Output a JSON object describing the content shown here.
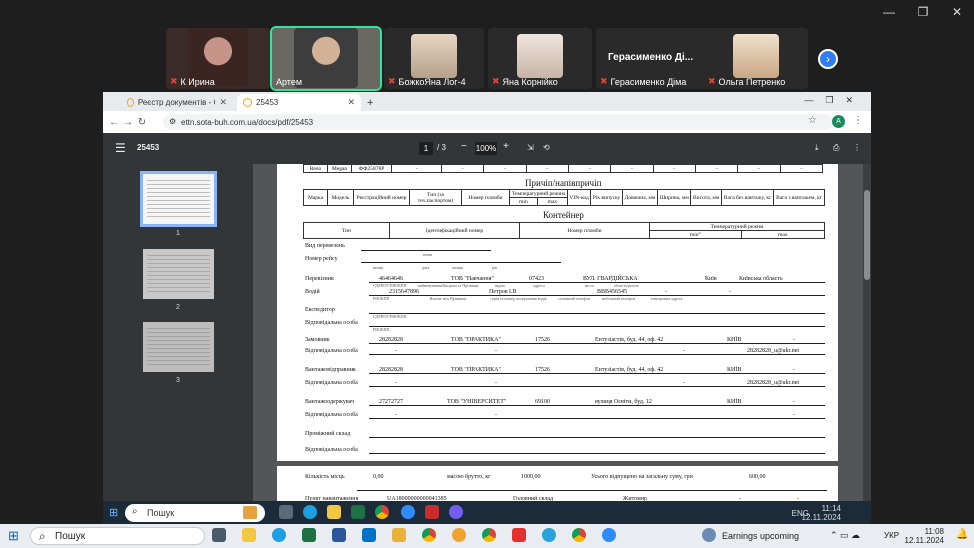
{
  "meeting": {
    "participants": [
      {
        "name": "К Ирина"
      },
      {
        "name": "Артем"
      },
      {
        "name": "БожкоЯна Лог-4"
      },
      {
        "name": "Яна Корнійко"
      },
      {
        "name": "Герасименко Діма",
        "header": "Герасименко  Ді..."
      },
      {
        "name": "Ольга Петренко"
      }
    ]
  },
  "browser": {
    "tabs": [
      {
        "label": "Реєстр документів - СОТА Е-Т"
      },
      {
        "label": "25453"
      }
    ],
    "url": "ettn.sota-buh.com.ua/docs/pdf/25453",
    "profile_initial": "A"
  },
  "pdf": {
    "title": "25453",
    "current_page": "1",
    "total_pages": "/ 3",
    "zoom": "100%",
    "thumbnails": [
      "1",
      "2",
      "3"
    ]
  },
  "document": {
    "top_row": {
      "make": "Reno",
      "model": "Megan",
      "reg": "ФФ25878Р",
      "dash": "-"
    },
    "trailers_title": "Причіп/напівпричіп",
    "trailer_headers": [
      "Марка",
      "Модель",
      "Реєстраційний номер",
      "Тип (за тех.паспортом)",
      "Номер пломби",
      "Температурний режим",
      "VIN-код",
      "Рік випуску",
      "Довжина, мм",
      "Ширина, мм",
      "Висота, мм",
      "Вага без вантажу, кг",
      "Вага з вантажем, кг"
    ],
    "temp_min": "min",
    "temp_max": "max",
    "container_title": "Контейнер",
    "container_headers": [
      "Тип",
      "Ідентифікаційний номер",
      "Номер пломби",
      "Температурний режим"
    ],
    "container_temp_min": "min°",
    "container_temp_max": "max",
    "transport_kind_label": "Вид перевезень",
    "trip_number_label": "Номер рейсу",
    "tiny_labels": {
      "kind": "назва",
      "route": "номер",
      "date": "дата",
      "month": "місяць",
      "year": "рік"
    },
    "sub": {
      "entity": "ЄДРПОУ/РНОКПП",
      "name": "найменування/Ініціали та Прізвище",
      "index": "індекс",
      "address": "адреса",
      "city": "місто",
      "region": "область/регіон",
      "rnokpp": "РНОКПП",
      "fio": "Власне ім'я Прізвище",
      "doc": "серія та номер посвідчення водія",
      "phone": "основний телефон",
      "mobile": "мобільний телефон",
      "email": "електронна адреса"
    },
    "carrier": {
      "label": "Перевізник",
      "code": "46464646",
      "name": "ТОВ \"Навчання\"",
      "index": "07423",
      "street": "ВУЛ. ГВАРДІЙСЬКА",
      "city": "Київ",
      "dash": "-",
      "region": "Київська область"
    },
    "driver": {
      "label": "Водій",
      "rnokpp": "2315647896",
      "name": "Петров І.В",
      "doc": "ВВВ456545",
      "dash": "-"
    },
    "forwarder": {
      "label": "Експедитор"
    },
    "responsible_label": "Відповідальна особа",
    "customer": {
      "label": "Замовник",
      "code": "28282828",
      "name": "ТОВ \"ПРАКТИКА\"",
      "index": "17526",
      "street": "Ентузіастів, буд. 44, оф. 42",
      "city": "КИЇВ",
      "dash": "-",
      "email": "28282828_u@ukr.net"
    },
    "shipper": {
      "label": "Вантажовідправник",
      "code": "28282828",
      "name": "ТОВ \"ПРАКТИКА\"",
      "index": "17526",
      "street": "Ентузіастів, буд. 44, оф. 42",
      "city": "КИЇВ",
      "dash": "-",
      "email": "28282828_u@ukr.net"
    },
    "consignee": {
      "label": "Вантажоодержувач",
      "code": "27272727",
      "name": "ТОВ \"УНІВЕРСИТЕТ\"",
      "index": "69100",
      "street": "вулиця Освіти, буд. 12",
      "city": "КИЇВ",
      "dash": "-"
    },
    "warehouse_label": "Проміжний склад",
    "page2": {
      "qty_label": "Кількість місць",
      "qty": "0,00",
      "gross_label": "масою брутто, кг",
      "gross": "1000,00",
      "total_label": "Усього відпущено на загальну суму, грн",
      "total": "600,00",
      "load_point_label": "Пункт навантаження",
      "load_point_code": "UA18000000000041385",
      "warehouse": "Головний склад",
      "city": "Житомир",
      "dash": "-"
    }
  },
  "inner_taskbar": {
    "search": "Пошук",
    "time": "11:14",
    "date": "12.11.2024",
    "lang": "ENG"
  },
  "taskbar": {
    "search": "Пошук",
    "weather": "Earnings upcoming",
    "lang": "УКР",
    "time": "11:08",
    "date": "12.11.2024"
  },
  "colors": {
    "accent": "#2f7cf6",
    "mic_muted": "#e0433a",
    "active_speaker": "#2ee59d"
  }
}
